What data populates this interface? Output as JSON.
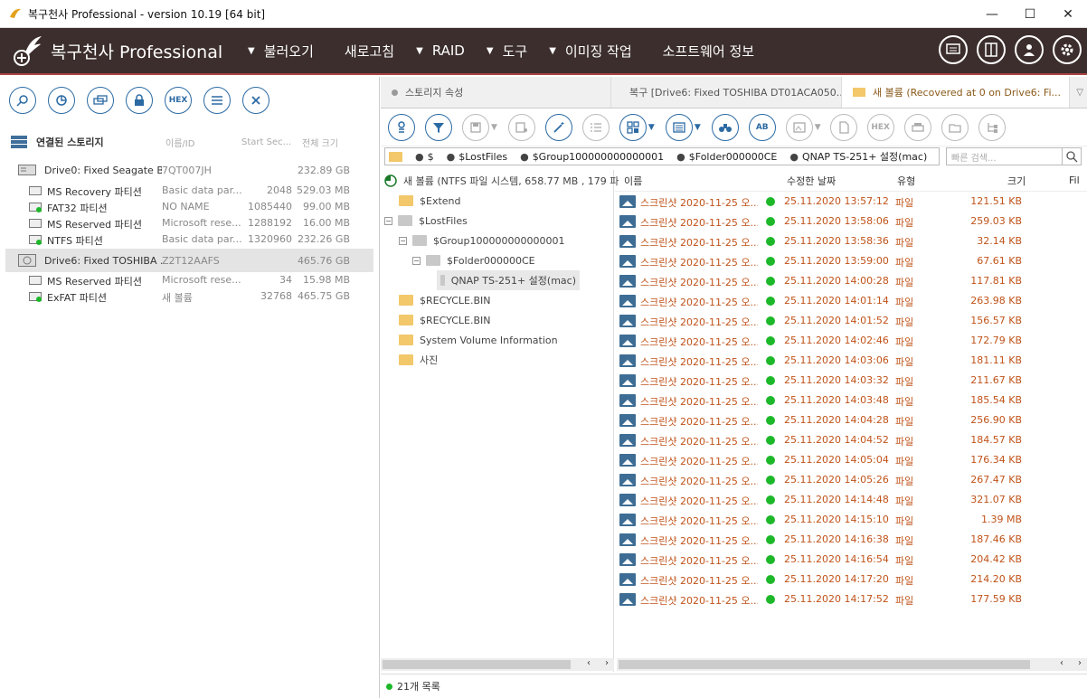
{
  "window": {
    "title": "복구천사 Professional - version 10.19 [64 bit]",
    "minimize": "—",
    "maximize": "☐",
    "close": "✕"
  },
  "app": {
    "logo_text": "복구천사 Professional"
  },
  "menu": {
    "items": [
      {
        "label": "불러오기",
        "arrow": "▼"
      },
      {
        "label": "새로고침",
        "arrow": ""
      },
      {
        "label": "RAID",
        "arrow": "▼"
      },
      {
        "label": "도구",
        "arrow": "▼"
      },
      {
        "label": "이미징 작업",
        "arrow": "▼"
      },
      {
        "label": "소프트웨어 정보",
        "arrow": ""
      }
    ]
  },
  "left_toolbar": {
    "hex_label": "HEX"
  },
  "storage": {
    "header": "연결된 스토리지",
    "col_name": "이름/ID",
    "col_start": "Start Sec...",
    "col_size": "전체 크기",
    "drives": [
      {
        "name": "Drive0: Fixed Seagate B...",
        "id": "7QT007JH",
        "start": "",
        "size": "232.89 GB",
        "partitions": [
          {
            "name": "MS Recovery 파티션",
            "id": "Basic data par...",
            "start": "2048",
            "size": "529.03 MB"
          },
          {
            "name": "FAT32 파티션",
            "id": "NO NAME",
            "start": "1085440",
            "size": "99.00 MB"
          },
          {
            "name": "MS Reserved 파티션",
            "id": "Microsoft rese...",
            "start": "1288192",
            "size": "16.00 MB"
          },
          {
            "name": "NTFS 파티션",
            "id": "Basic data par...",
            "start": "1320960",
            "size": "232.26 GB"
          }
        ]
      },
      {
        "name": "Drive6: Fixed TOSHIBA ...",
        "id": "Z2T12AAFS",
        "start": "",
        "size": "465.76 GB",
        "partitions": [
          {
            "name": "MS Reserved 파티션",
            "id": "Microsoft rese...",
            "start": "34",
            "size": "15.98 MB"
          },
          {
            "name": "ExFAT 파티션",
            "id": "새 볼륨",
            "start": "32768",
            "size": "465.75 GB"
          }
        ]
      }
    ]
  },
  "tabs": [
    {
      "label": "스토리지 속성",
      "dot": "#999999"
    },
    {
      "label": "복구 [Drive6: Fixed TOSHIBA DT01ACA050...",
      "dot": "#c0392b"
    },
    {
      "label": "새 볼륨 (Recovered at 0 on Drive6: Fi...",
      "dot": ""
    }
  ],
  "right_toolbar": {
    "hex_label": "HEX",
    "ab_label": "AB"
  },
  "path": {
    "segments": [
      "$",
      "$LostFiles",
      "$Group100000000000001",
      "$Folder000000CE",
      "QNAP TS-251+ 설정(mac)"
    ]
  },
  "search": {
    "placeholder": "빠른 검색..."
  },
  "tree": {
    "root": "새 볼륨 (NTFS 파일 시스템, 658.77 MB , 179 파",
    "nodes": [
      {
        "label": "$Extend",
        "expander": ""
      },
      {
        "label": "$LostFiles",
        "expander": "−"
      },
      {
        "label": "$Group100000000000001",
        "expander": "−"
      },
      {
        "label": "$Folder000000CE",
        "expander": "−"
      },
      {
        "label": "QNAP TS-251+ 설정(mac)",
        "expander": ""
      },
      {
        "label": "$RECYCLE.BIN",
        "expander": ""
      },
      {
        "label": "$RECYCLE.BIN",
        "expander": ""
      },
      {
        "label": "System Volume Information",
        "expander": ""
      },
      {
        "label": "사진",
        "expander": ""
      }
    ]
  },
  "file_list": {
    "columns": {
      "name": "이름",
      "modified": "수정한 날짜",
      "type": "유형",
      "size": "크기",
      "extra": "Fil"
    },
    "rows": [
      {
        "name": "스크린샷 2020-11-25 오...",
        "modified": "25.11.2020 13:57:12",
        "type": "파일",
        "size": "121.51 KB"
      },
      {
        "name": "스크린샷 2020-11-25 오...",
        "modified": "25.11.2020 13:58:06",
        "type": "파일",
        "size": "259.03 KB"
      },
      {
        "name": "스크린샷 2020-11-25 오...",
        "modified": "25.11.2020 13:58:36",
        "type": "파일",
        "size": "32.14 KB"
      },
      {
        "name": "스크린샷 2020-11-25 오...",
        "modified": "25.11.2020 13:59:00",
        "type": "파일",
        "size": "67.61 KB"
      },
      {
        "name": "스크린샷 2020-11-25 오...",
        "modified": "25.11.2020 14:00:28",
        "type": "파일",
        "size": "117.81 KB"
      },
      {
        "name": "스크린샷 2020-11-25 오...",
        "modified": "25.11.2020 14:01:14",
        "type": "파일",
        "size": "263.98 KB"
      },
      {
        "name": "스크린샷 2020-11-25 오...",
        "modified": "25.11.2020 14:01:52",
        "type": "파일",
        "size": "156.57 KB"
      },
      {
        "name": "스크린샷 2020-11-25 오...",
        "modified": "25.11.2020 14:02:46",
        "type": "파일",
        "size": "172.79 KB"
      },
      {
        "name": "스크린샷 2020-11-25 오...",
        "modified": "25.11.2020 14:03:06",
        "type": "파일",
        "size": "181.11 KB"
      },
      {
        "name": "스크린샷 2020-11-25 오...",
        "modified": "25.11.2020 14:03:32",
        "type": "파일",
        "size": "211.67 KB"
      },
      {
        "name": "스크린샷 2020-11-25 오...",
        "modified": "25.11.2020 14:03:48",
        "type": "파일",
        "size": "185.54 KB"
      },
      {
        "name": "스크린샷 2020-11-25 오...",
        "modified": "25.11.2020 14:04:28",
        "type": "파일",
        "size": "256.90 KB"
      },
      {
        "name": "스크린샷 2020-11-25 오...",
        "modified": "25.11.2020 14:04:52",
        "type": "파일",
        "size": "184.57 KB"
      },
      {
        "name": "스크린샷 2020-11-25 오...",
        "modified": "25.11.2020 14:05:04",
        "type": "파일",
        "size": "176.34 KB"
      },
      {
        "name": "스크린샷 2020-11-25 오...",
        "modified": "25.11.2020 14:05:26",
        "type": "파일",
        "size": "267.47 KB"
      },
      {
        "name": "스크린샷 2020-11-25 오...",
        "modified": "25.11.2020 14:14:48",
        "type": "파일",
        "size": "321.07 KB"
      },
      {
        "name": "스크린샷 2020-11-25 오...",
        "modified": "25.11.2020 14:15:10",
        "type": "파일",
        "size": "1.39 MB"
      },
      {
        "name": "스크린샷 2020-11-25 오...",
        "modified": "25.11.2020 14:16:38",
        "type": "파일",
        "size": "187.46 KB"
      },
      {
        "name": "스크린샷 2020-11-25 오...",
        "modified": "25.11.2020 14:16:54",
        "type": "파일",
        "size": "204.42 KB"
      },
      {
        "name": "스크린샷 2020-11-25 오...",
        "modified": "25.11.2020 14:17:20",
        "type": "파일",
        "size": "214.20 KB"
      },
      {
        "name": "스크린샷 2020-11-25 오...",
        "modified": "25.11.2020 14:17:52",
        "type": "파일",
        "size": "177.59 KB"
      }
    ]
  },
  "status": {
    "text": "21개 목록"
  },
  "colors": {
    "menubar": "#3b2e2c",
    "accent_blue": "#2b6aa3",
    "ok_green": "#1db82a",
    "file_orange": "#c0531a"
  }
}
